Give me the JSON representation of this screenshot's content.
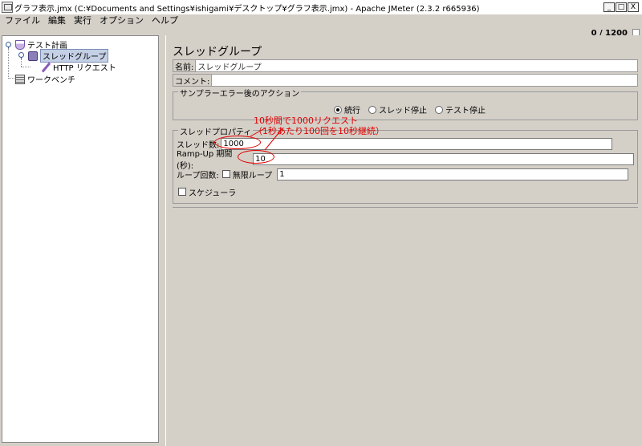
{
  "window": {
    "title": "グラフ表示.jmx (C:¥Documents and Settings¥ishigami¥デスクトップ¥グラフ表示.jmx) - Apache JMeter (2.3.2 r665936)",
    "buttons": {
      "minimize": "_",
      "maximize": "□",
      "close": "X"
    }
  },
  "menu": [
    "ファイル",
    "編集",
    "実行",
    "オプション",
    "ヘルプ"
  ],
  "counter": "0 / 1200",
  "tree": {
    "test_plan": "テスト計画",
    "thread_group": "スレッドグループ",
    "http_request": "HTTP リクエスト",
    "workbench": "ワークベンチ"
  },
  "panel": {
    "title": "スレッドグループ",
    "name_label": "名前:",
    "name_value": "スレッドグループ",
    "comment_label": "コメント:",
    "comment_value": "",
    "sampler_error": {
      "title": "サンプラーエラー後のアクション",
      "options": [
        "続行",
        "スレッド停止",
        "テスト停止"
      ],
      "selected": "続行"
    },
    "thread_props": {
      "title": "スレッドプロパティ",
      "threads_label": "スレッド数:",
      "threads_value": "1000",
      "rampup_label": "Ramp-Up 期間 (秒):",
      "rampup_value": "10",
      "loop_label": "ループ回数:",
      "infinite_label": "無限ループ",
      "loop_value": "1",
      "scheduler_label": "スケジューラ"
    }
  },
  "annotation": {
    "line1": "10秒間で1000リクエスト",
    "line2": "（1秒あたり100回を10秒継続）",
    "color": "#e00000"
  }
}
